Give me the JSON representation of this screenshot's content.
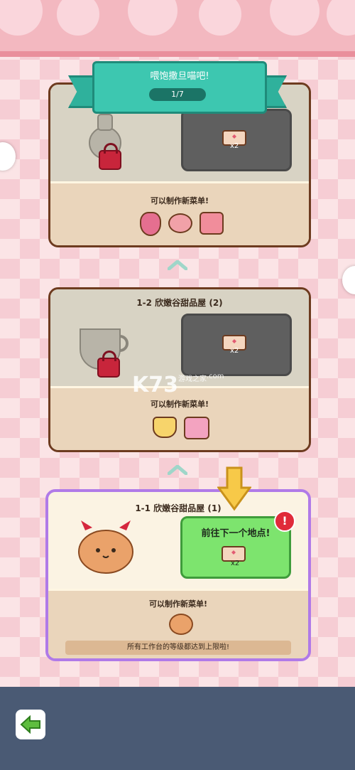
{
  "header": {
    "title": "喂饱撒旦喵吧!",
    "pager": "1/7"
  },
  "cards": [
    {
      "title": "",
      "menu_label": "可以制作新菜单!",
      "reward_count": "x2",
      "locked": true
    },
    {
      "title": "1-2 欣嫩谷甜品屋 (2)",
      "menu_label": "可以制作新菜单!",
      "reward_count": "x2",
      "locked": true
    },
    {
      "title": "1-1 欣嫩谷甜品屋 (1)",
      "menu_label": "可以制作新菜单!",
      "reward_count": "x2",
      "goto_label": "前往下一个地点!",
      "alert": "!",
      "footer_note": "所有工作台的等级都达到上限啦!"
    }
  ],
  "watermark": {
    "brand": "K73",
    "sub": "游戏之家",
    "domain": ".com"
  }
}
